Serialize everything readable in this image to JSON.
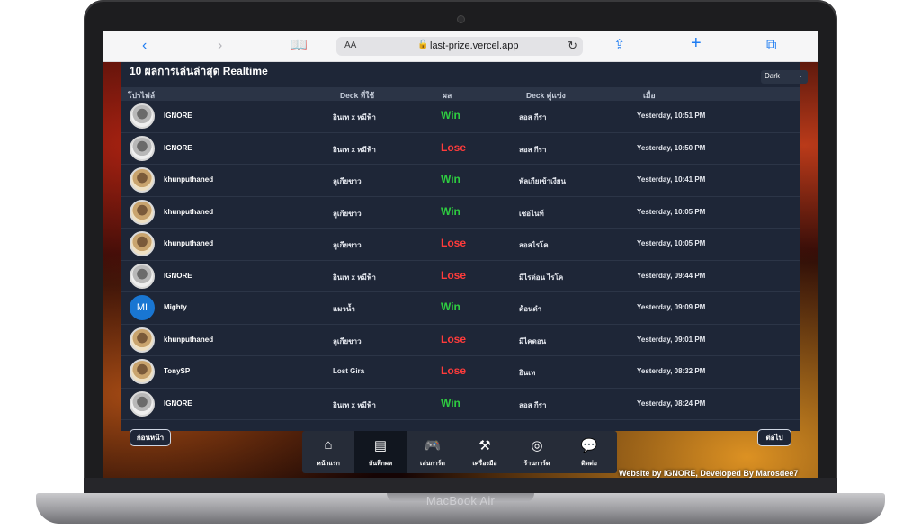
{
  "device": {
    "label": "MacBook Air"
  },
  "browser": {
    "text_size_label": "AA",
    "url": "last-prize.vercel.app"
  },
  "page": {
    "title": "10 ผลการเล่นล่าสุด Realtime",
    "theme_select": {
      "value": "Dark"
    },
    "columns": {
      "profile": "โปรไฟล์",
      "deck": "Deck ที่ใช้",
      "result": "ผล",
      "opponent": "Deck คู่แข่ง",
      "when": "เมื่อ"
    },
    "rows": [
      {
        "avatar": "photo",
        "name": "IGNORE",
        "deck": "อินเท x หมีฟ้า",
        "result": "Win",
        "opponent": "ลอส กีรา",
        "when": "Yesterday, 10:51 PM"
      },
      {
        "avatar": "photo",
        "name": "IGNORE",
        "deck": "อินเท x หมีฟ้า",
        "result": "Lose",
        "opponent": "ลอส กีรา",
        "when": "Yesterday, 10:50 PM"
      },
      {
        "avatar": "photo2",
        "name": "khunputhaned",
        "deck": "ลูเกียขาว",
        "result": "Win",
        "opponent": "พัลเกียเข้าเงียน",
        "when": "Yesterday, 10:41 PM"
      },
      {
        "avatar": "photo2",
        "name": "khunputhaned",
        "deck": "ลูเกียขาว",
        "result": "Win",
        "opponent": "เซอไนท์",
        "when": "Yesterday, 10:05 PM"
      },
      {
        "avatar": "photo2",
        "name": "khunputhaned",
        "deck": "ลูเกียขาว",
        "result": "Lose",
        "opponent": "ลอสไรโค",
        "when": "Yesterday, 10:05 PM"
      },
      {
        "avatar": "photo",
        "name": "IGNORE",
        "deck": "อินเท x หมีฟ้า",
        "result": "Lose",
        "opponent": "มีไรด่อน ไรโค",
        "when": "Yesterday, 09:44 PM"
      },
      {
        "avatar": "initials",
        "initials": "MI",
        "name": "Mighty",
        "deck": "แมวน้ำ",
        "result": "Win",
        "opponent": "ด้อนดำ",
        "when": "Yesterday, 09:09 PM"
      },
      {
        "avatar": "photo2",
        "name": "khunputhaned",
        "deck": "ลูเกียขาว",
        "result": "Lose",
        "opponent": "มีไคดอน",
        "when": "Yesterday, 09:01 PM"
      },
      {
        "avatar": "photo2",
        "name": "TonySP",
        "deck": "Lost Gira",
        "result": "Lose",
        "opponent": "อินเท",
        "when": "Yesterday, 08:32 PM"
      },
      {
        "avatar": "photo",
        "name": "IGNORE",
        "deck": "อินเท x หมีฟ้า",
        "result": "Win",
        "opponent": "ลอส กีรา",
        "when": "Yesterday, 08:24 PM"
      }
    ],
    "prev_button": "ก่อนหน้า",
    "next_button": "ต่อไป",
    "nav": [
      {
        "label": "หน้าแรก",
        "icon": "home-icon",
        "glyph": "⌂",
        "active": false
      },
      {
        "label": "บันทึกผล",
        "icon": "record-icon",
        "glyph": "▤",
        "active": true
      },
      {
        "label": "เล่นการ์ด",
        "icon": "gamepad-icon",
        "glyph": "🎮",
        "active": false
      },
      {
        "label": "เครื่องมือ",
        "icon": "tools-icon",
        "glyph": "⚒",
        "active": false
      },
      {
        "label": "ร้านการ์ด",
        "icon": "pokeball-icon",
        "glyph": "◎",
        "active": false
      },
      {
        "label": "ติดต่อ",
        "icon": "chat-icon",
        "glyph": "💬",
        "active": false
      }
    ],
    "footer": "Website by IGNORE, Developed By Marosdee7"
  }
}
